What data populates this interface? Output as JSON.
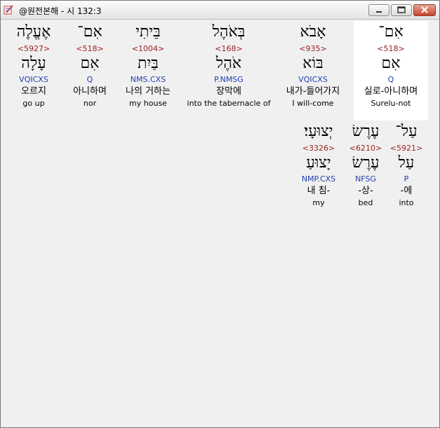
{
  "window": {
    "title": "@원전본해 - 시 132:3"
  },
  "row1": [
    {
      "heb": "אֶעֱלֶה",
      "strong": "<5927>",
      "lemma": "עָלָה",
      "parse": "VQICXS",
      "korean": "오르지",
      "english": "go up"
    },
    {
      "heb": "אִם־",
      "strong": "<518>",
      "lemma": "אִם",
      "parse": "Q",
      "korean": "아니하며",
      "english": "nor"
    },
    {
      "heb": "בֵּיתִי",
      "strong": "<1004>",
      "lemma": "בַּיִת",
      "parse": "NMS.CXS",
      "korean": "나의 거하는",
      "english": "my house"
    },
    {
      "heb": "בְּאֹהֶל",
      "strong": "<168>",
      "lemma": "אֹהֶל",
      "parse": "P.NMSG",
      "korean": "장막에",
      "english": "into the tabernacle of"
    },
    {
      "heb": "אָבֹא",
      "strong": "<935>",
      "lemma": "בּוֹא",
      "parse": "VQICXS",
      "korean": "내가-들어가지",
      "english": "I will-come"
    },
    {
      "heb": "אִם־",
      "strong": "<518>",
      "lemma": "אִם",
      "parse": "Q",
      "korean": "실로-아니하며",
      "english": "Surelu-not"
    }
  ],
  "row2": [
    {
      "heb": "יְצוּעָי׃",
      "strong": "<3326>",
      "lemma": "יָצוּעַ",
      "parse": "NMP.CXS",
      "korean": "내 침-",
      "english": "my"
    },
    {
      "heb": "עֶרֶשׂ",
      "strong": "<6210>",
      "lemma": "עֶרֶשׂ",
      "parse": "NFSG",
      "korean": "-상-",
      "english": "bed"
    },
    {
      "heb": "עַל־",
      "strong": "<5921>",
      "lemma": "עַל",
      "parse": "P",
      "korean": "-에",
      "english": "into"
    }
  ]
}
